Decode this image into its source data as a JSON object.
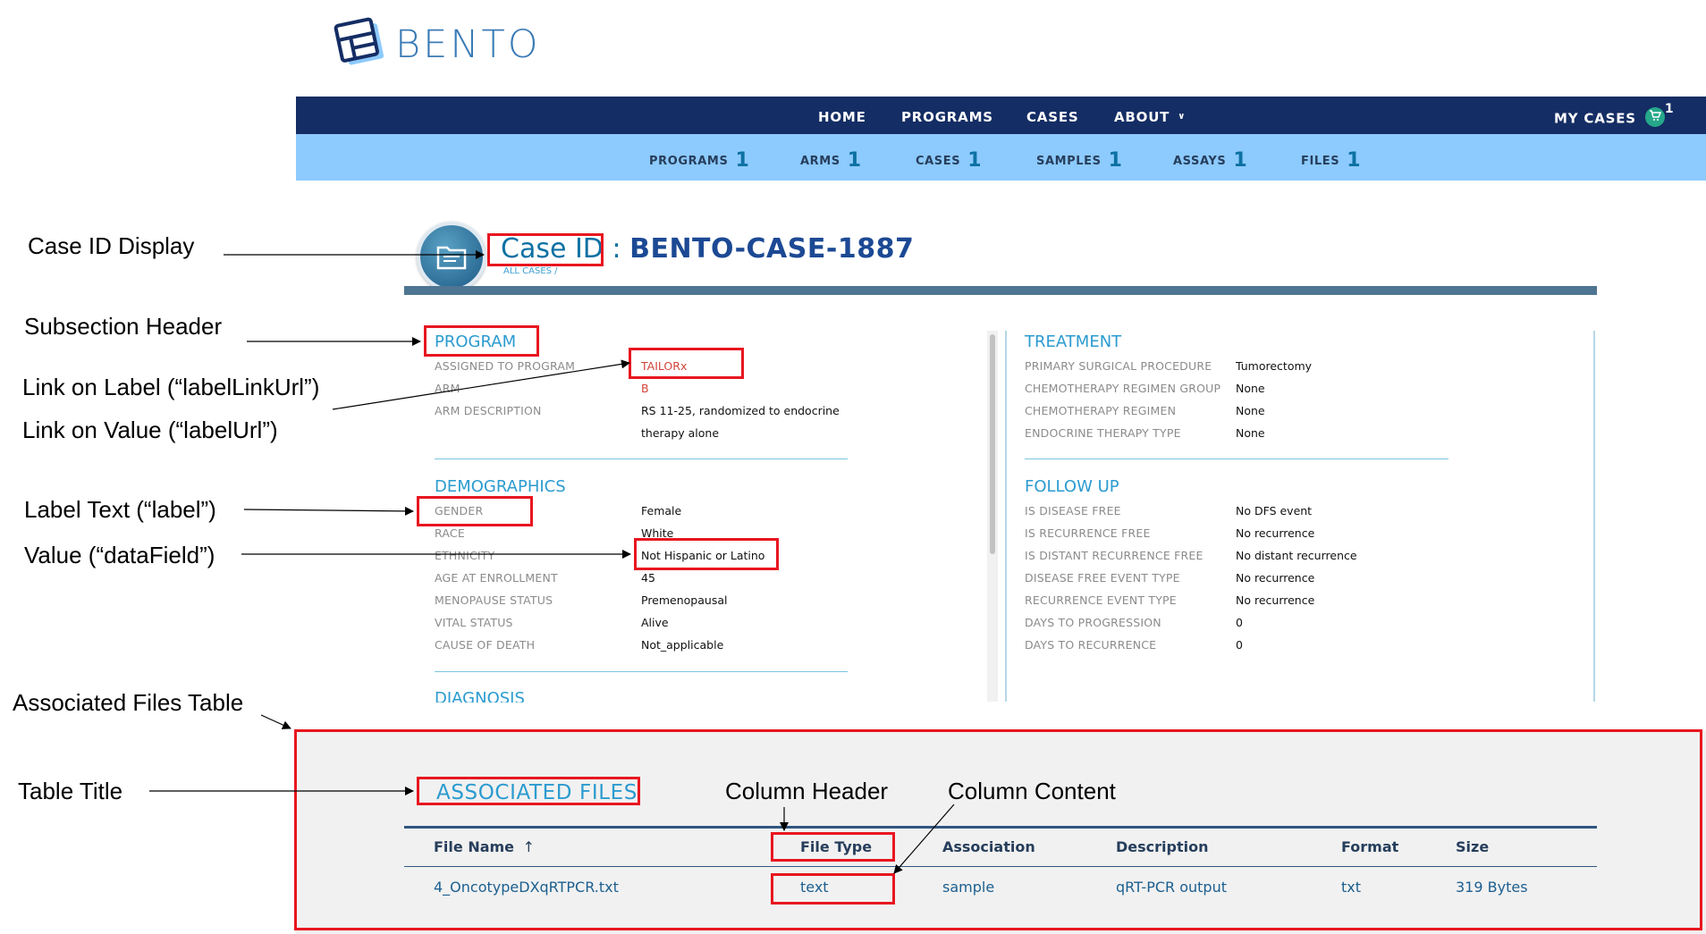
{
  "logo": {
    "text": "BENTO"
  },
  "nav": {
    "items": [
      "HOME",
      "PROGRAMS",
      "CASES",
      "ABOUT"
    ],
    "about_chevron": "⌄",
    "my_cases": "MY CASES",
    "cart_count": "1"
  },
  "stats": [
    {
      "label": "PROGRAMS",
      "count": "1"
    },
    {
      "label": "ARMS",
      "count": "1"
    },
    {
      "label": "CASES",
      "count": "1"
    },
    {
      "label": "SAMPLES",
      "count": "1"
    },
    {
      "label": "ASSAYS",
      "count": "1"
    },
    {
      "label": "FILES",
      "count": "1"
    }
  ],
  "case": {
    "id_label": "Case ID :",
    "id_value": "BENTO-CASE-1887",
    "breadcrumb": "ALL CASES /"
  },
  "program": {
    "header": "PROGRAM",
    "rows": [
      {
        "label": "ASSIGNED TO PROGRAM",
        "value": "TAILORx"
      },
      {
        "label": "ARM",
        "value": "B"
      },
      {
        "label": "ARM DESCRIPTION",
        "value": "RS 11-25, randomized to endocrine",
        "value2": "therapy alone"
      }
    ]
  },
  "demographics": {
    "header": "DEMOGRAPHICS",
    "rows": [
      {
        "label": "GENDER",
        "value": "Female"
      },
      {
        "label": "RACE",
        "value": "White"
      },
      {
        "label": "ETHNICITY",
        "value": "Not Hispanic or Latino"
      },
      {
        "label": "AGE AT ENROLLMENT",
        "value": "45"
      },
      {
        "label": "MENOPAUSE STATUS",
        "value": "Premenopausal"
      },
      {
        "label": "VITAL STATUS",
        "value": "Alive"
      },
      {
        "label": "CAUSE OF DEATH",
        "value": "Not_applicable"
      }
    ]
  },
  "diagnosis": {
    "header": "DIAGNOSIS"
  },
  "treatment": {
    "header": "TREATMENT",
    "rows": [
      {
        "label": "PRIMARY SURGICAL PROCEDURE",
        "value": "Tumorectomy"
      },
      {
        "label": "CHEMOTHERAPY REGIMEN GROUP",
        "value": "None"
      },
      {
        "label": "CHEMOTHERAPY REGIMEN",
        "value": "None"
      },
      {
        "label": "ENDOCRINE THERAPY TYPE",
        "value": "None"
      }
    ]
  },
  "followup": {
    "header": "FOLLOW UP",
    "rows": [
      {
        "label": "IS DISEASE FREE",
        "value": "No DFS event"
      },
      {
        "label": "IS RECURRENCE FREE",
        "value": "No recurrence"
      },
      {
        "label": "IS DISTANT RECURRENCE FREE",
        "value": "No distant recurrence"
      },
      {
        "label": "DISEASE FREE EVENT TYPE",
        "value": "No recurrence"
      },
      {
        "label": "RECURRENCE EVENT TYPE",
        "value": "No recurrence"
      },
      {
        "label": "DAYS TO PROGRESSION",
        "value": "0"
      },
      {
        "label": "DAYS TO RECURRENCE",
        "value": "0"
      }
    ]
  },
  "files": {
    "title": "ASSOCIATED FILES",
    "columns": [
      "File Name",
      "File Type",
      "Association",
      "Description",
      "Format",
      "Size"
    ],
    "sort_icon": "↑",
    "rows": [
      [
        "4_OncotypeDXqRTPCR.txt",
        "text",
        "sample",
        "qRT-PCR output",
        "txt",
        "319 Bytes"
      ]
    ]
  },
  "annotations": {
    "case_id_display": "Case ID Display",
    "subsection_header": "Subsection Header",
    "link_on_label": "Link on Label (“labelLinkUrl”)",
    "link_on_value": "Link on Value (“labelUrl”)",
    "label_text": "Label Text (“label”)",
    "value_datafield": "Value (“dataField”)",
    "associated_files_table": "Associated Files Table",
    "table_title": "Table Title",
    "column_header": "Column Header",
    "column_content": "Column Content"
  },
  "colors": {
    "navbar": "#142d64",
    "statsbar": "#8dcafe",
    "accent": "#2b9bd0",
    "annotation_red": "#e8161f"
  }
}
